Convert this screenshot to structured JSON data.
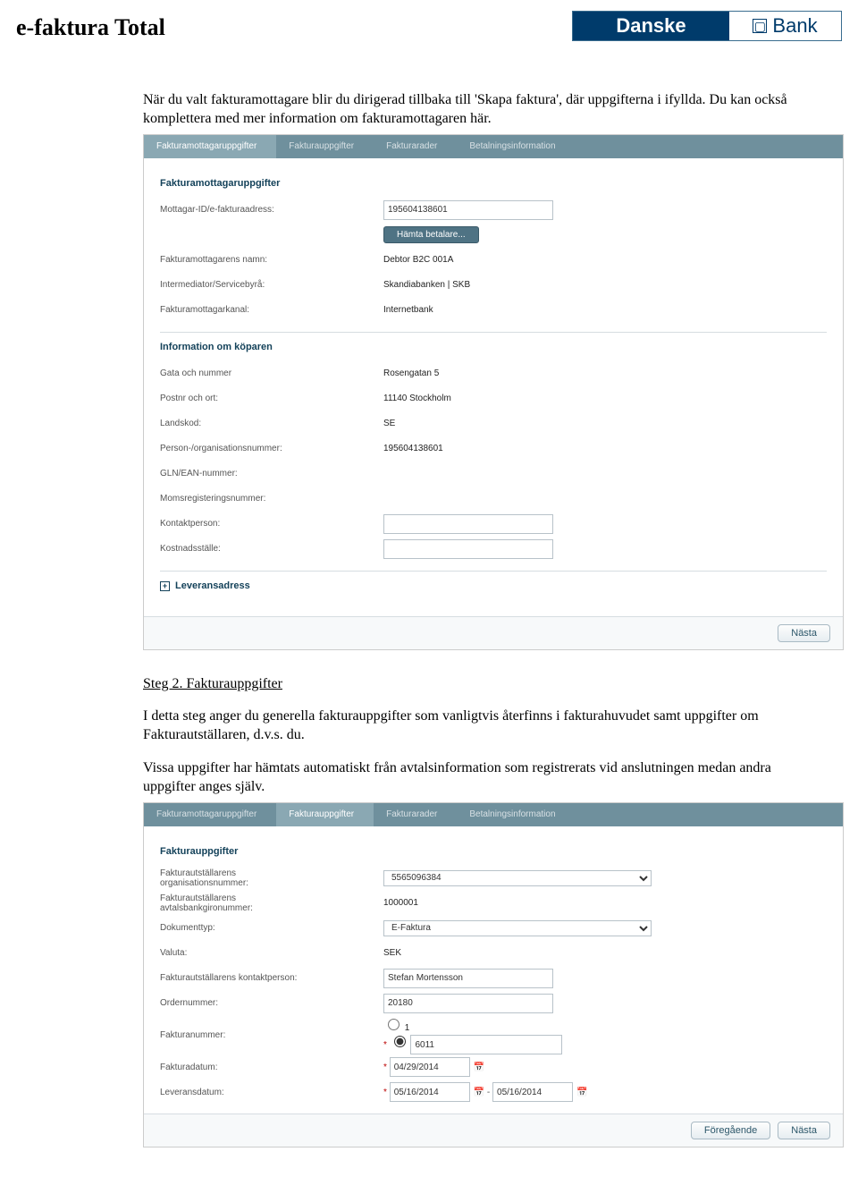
{
  "header": {
    "title": "e-faktura Total",
    "logo_left": "Danske",
    "logo_right": "Bank",
    "logo_sq": "□"
  },
  "intro": {
    "p1": "När du valt fakturamottagare blir du dirigerad tillbaka till 'Skapa faktura', där uppgifterna i ifyllda. Du kan också komplettera med mer information om fakturamottagaren här."
  },
  "app1": {
    "tabs": [
      "Fakturamottagaruppgifter",
      "Fakturauppgifter",
      "Fakturarader",
      "Betalningsinformation"
    ],
    "sec1": "Fakturamottagaruppgifter",
    "r1l": "Mottagar-ID/e-fakturaadress:",
    "r1v": "195604138601",
    "btn_fetch": "Hämta betalare...",
    "r2l": "Fakturamottagarens namn:",
    "r2v": "Debtor B2C 001A",
    "r3l": "Intermediator/Servicebyrå:",
    "r3v": "Skandiabanken | SKB",
    "r4l": "Fakturamottagarkanal:",
    "r4v": "Internetbank",
    "sec2": "Information om köparen",
    "b1l": "Gata och nummer",
    "b1v": "Rosengatan 5",
    "b2l": "Postnr och ort:",
    "b2v": "11140 Stockholm",
    "b3l": "Landskod:",
    "b3v": "SE",
    "b4l": "Person-/organisationsnummer:",
    "b4v": "195604138601",
    "b5l": "GLN/EAN-nummer:",
    "b6l": "Momsregisteringsnummer:",
    "b7l": "Kontaktperson:",
    "b7v": "",
    "b8l": "Kostnadsställe:",
    "b8v": "",
    "expand": "Leveransadress",
    "btn_next": "Nästa"
  },
  "step2": {
    "h": "Steg 2. Fakturauppgifter",
    "p1": "I detta steg anger du generella fakturauppgifter som vanligtvis återfinns i fakturahuvudet samt uppgifter om Fakturautställaren, d.v.s. du.",
    "p2": "Vissa uppgifter har hämtats automatiskt från avtalsinformation som registrerats vid anslutningen medan andra uppgifter anges själv."
  },
  "app2": {
    "tabs": [
      "Fakturamottagaruppgifter",
      "Fakturauppgifter",
      "Fakturarader",
      "Betalningsinformation"
    ],
    "sec1": "Fakturauppgifter",
    "r1l": "Fakturautställarens\norganisationsnummer:",
    "r1v": "5565096384",
    "r2l": "Fakturautställarens\navtalsbankgironummer:",
    "r2v": "1000001",
    "r3l": "Dokumenttyp:",
    "r3v": "E-Faktura",
    "r4l": "Valuta:",
    "r4v": "SEK",
    "r5l": "Fakturautställarens kontaktperson:",
    "r5v": "Stefan Mortensson",
    "r6l": "Ordernummer:",
    "r6v": "20180",
    "r7l": "Fakturanummer:",
    "r7a": "1",
    "r7b": "6011",
    "r8l": "Fakturadatum:",
    "r8v": "04/29/2014",
    "r9l": "Leveransdatum:",
    "r9a": "05/16/2014",
    "r9b": "05/16/2014",
    "btn_prev": "Föregående",
    "btn_next": "Nästa"
  }
}
